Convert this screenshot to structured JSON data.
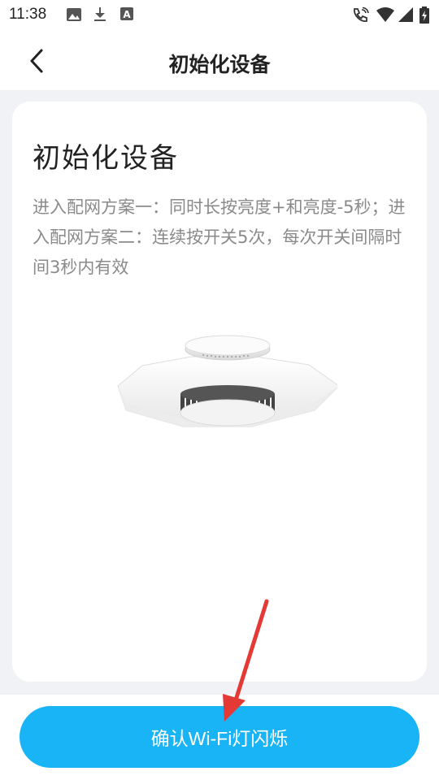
{
  "status_bar": {
    "time": "11:38",
    "icons": [
      "image-icon",
      "download-icon",
      "text-a-icon",
      "wifi-call-icon",
      "wifi-icon",
      "signal-icon",
      "battery-charging-icon"
    ]
  },
  "header": {
    "title": "初始化设备",
    "back_icon": "chevron-left-icon"
  },
  "card": {
    "title": "初始化设备",
    "description": "进入配网方案一：同时长按亮度+和亮度-5秒；进入配网方案二：连续按开关5次，每次开关间隔时间3秒内有效",
    "illustration": "ceiling-light-image"
  },
  "footer": {
    "confirm_label": "确认Wi-Fi灯闪烁"
  },
  "colors": {
    "accent": "#19b4f6",
    "annotation_arrow": "#e53935"
  }
}
